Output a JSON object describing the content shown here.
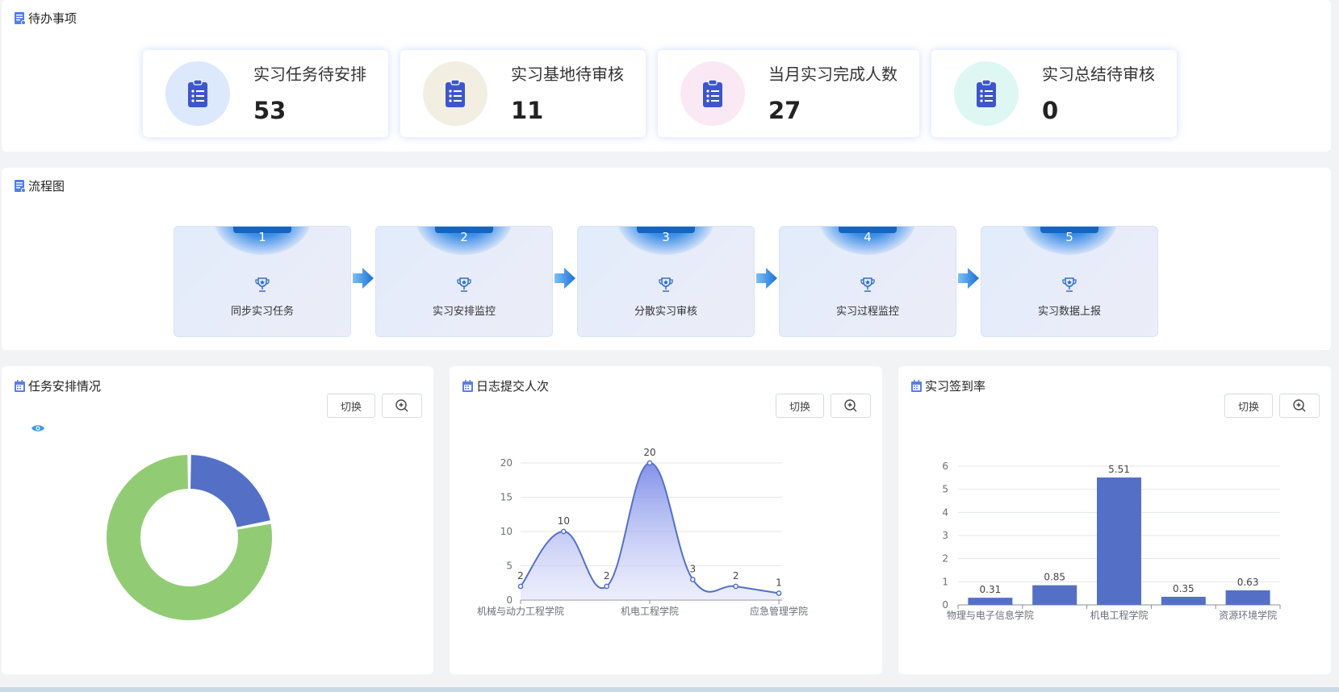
{
  "todo": {
    "title": "待办事项",
    "cards": [
      {
        "label": "实习任务待安排",
        "value": "53",
        "circle_color": "#dce8fb"
      },
      {
        "label": "实习基地待审核",
        "value": "11",
        "circle_color": "#f2efe2"
      },
      {
        "label": "当月实习完成人数",
        "value": "27",
        "circle_color": "#fbe8f5"
      },
      {
        "label": "实习总结待审核",
        "value": "0",
        "circle_color": "#dff7f3"
      }
    ]
  },
  "flow": {
    "title": "流程图",
    "steps": [
      {
        "num": "1",
        "name": "同步实习任务"
      },
      {
        "num": "2",
        "name": "实习安排监控"
      },
      {
        "num": "3",
        "name": "分散实习审核"
      },
      {
        "num": "4",
        "name": "实习过程监控"
      },
      {
        "num": "5",
        "name": "实习数据上报"
      }
    ]
  },
  "panels": {
    "task": {
      "title": "任务安排情况",
      "switch_label": "切换",
      "zoom_icon": "zoom-in-icon"
    },
    "log": {
      "title": "日志提交人次",
      "switch_label": "切换",
      "zoom_icon": "zoom-in-icon"
    },
    "signin": {
      "title": "实习签到率",
      "switch_label": "切换",
      "zoom_icon": "zoom-in-icon"
    }
  },
  "colors": {
    "accent": "#5470c6",
    "green": "#91cc75",
    "step_badge": "#1565c0",
    "eye": "#3a9ae8"
  },
  "chart_data": [
    {
      "type": "pie",
      "variant": "donut",
      "values": [
        22,
        78
      ],
      "slice_colors": [
        "#5470c6",
        "#91cc75"
      ]
    },
    {
      "type": "area",
      "categories": [
        "机械与动力工程学院",
        "",
        "",
        "机电工程学院",
        "",
        "",
        "应急管理学院"
      ],
      "visible_tick_labels": [
        "机械与动力工程学院",
        "机电工程学院",
        "应急管理学院"
      ],
      "values": [
        2,
        10,
        2,
        20,
        3,
        2,
        1
      ],
      "data_labels": [
        "2",
        "10",
        "2",
        "20",
        "3",
        "2",
        "1"
      ],
      "ylim": [
        0,
        20
      ],
      "yticks": [
        "0",
        "5",
        "10",
        "15",
        "20"
      ],
      "smooth": true,
      "grid": true
    },
    {
      "type": "bar",
      "categories": [
        "物理与电子信息学院",
        "",
        "机电工程学院",
        "",
        "资源环境学院"
      ],
      "visible_tick_labels": [
        "物理与电子信息学院",
        "机电工程学院",
        "资源环境学院"
      ],
      "values": [
        0.31,
        0.85,
        5.51,
        0.35,
        0.63
      ],
      "data_labels": [
        "0.31",
        "0.85",
        "5.51",
        "0.35",
        "0.63"
      ],
      "ylim": [
        0,
        6
      ],
      "yticks": [
        "0",
        "1",
        "2",
        "3",
        "4",
        "5",
        "6"
      ],
      "grid": true
    }
  ]
}
